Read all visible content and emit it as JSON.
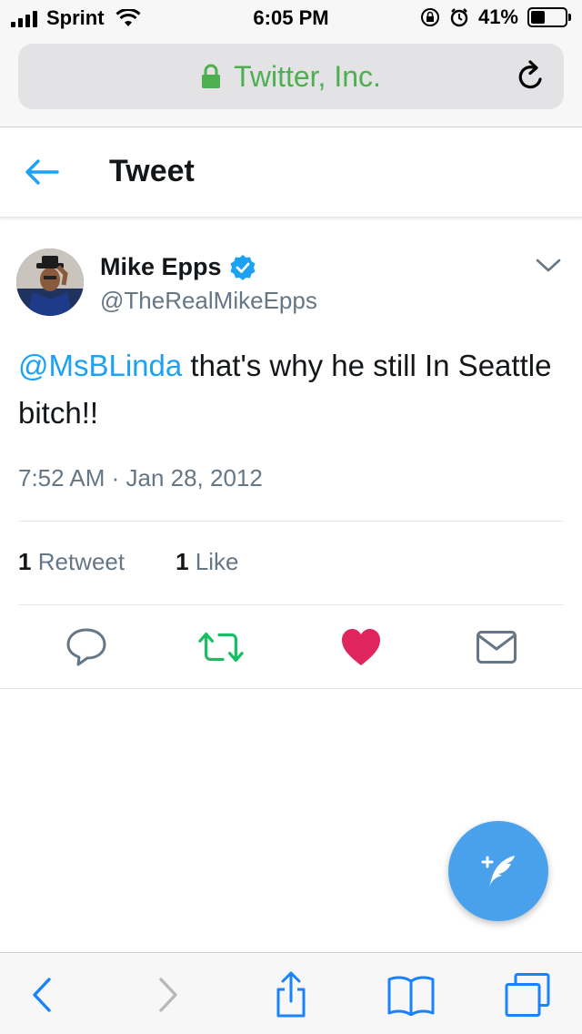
{
  "status_bar": {
    "carrier": "Sprint",
    "time": "6:05 PM",
    "battery": "41%",
    "battery_level": 0.41
  },
  "browser": {
    "url_title": "Twitter, Inc.",
    "secure_icon": "lock-icon",
    "reload_icon": "reload-icon"
  },
  "header": {
    "back_icon": "back-arrow-icon",
    "title": "Tweet"
  },
  "tweet": {
    "author_name": "Mike Epps",
    "handle": "@TheRealMikeEpps",
    "mention": "@MsBLinda",
    "text": " that's why he still In Seattle bitch!!",
    "timestamp": "7:52 AM · Jan 28, 2012",
    "retweet_count": "1",
    "retweet_label": "Retweet",
    "like_count": "1",
    "like_label": "Like"
  },
  "actions": {
    "reply_icon": "reply-icon",
    "retweet_icon": "retweet-icon",
    "like_icon": "heart-icon",
    "dm_icon": "envelope-icon",
    "retweet_color": "#17bf63",
    "like_color": "#e0245e"
  },
  "fab": {
    "icon": "compose-tweet-icon",
    "color": "#4aa1eb"
  },
  "toolbar": {
    "items": [
      "back-icon",
      "forward-icon",
      "share-icon",
      "bookmarks-icon",
      "tabs-icon"
    ]
  },
  "colors": {
    "accent": "#1da1f2",
    "secure_green": "#4caf50",
    "secondary_text": "#657786"
  }
}
